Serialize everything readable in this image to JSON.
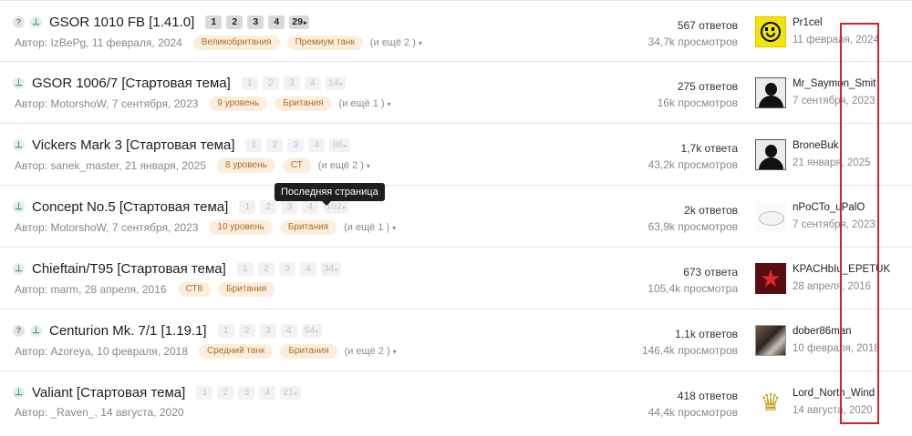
{
  "tooltip": "Последняя страница",
  "colors": {
    "tag_bg": "#fbeedd",
    "tag_text": "#b36b1c",
    "pin_icon": "#3aa36b",
    "highlight_box": "#d8212b",
    "tooltip_bg": "#1e1e1e"
  },
  "topics": [
    {
      "question_icon": true,
      "pin_icon": true,
      "title": "GSOR 1010 FB [1.41.0]",
      "pages_style": "dark",
      "pages": [
        "1",
        "2",
        "3",
        "4",
        "29"
      ],
      "author": "Автор: IzBePg, 11 февраля, 2024",
      "tags": [
        "Великобритания",
        "Премиум танк"
      ],
      "more": "(и ещё 2 )",
      "replies": "567 ответов",
      "views": "34,7k просмотров",
      "avatar": "sun",
      "last_user": "Pr1cel",
      "last_date": "11 февраля, 2024"
    },
    {
      "question_icon": false,
      "pin_icon": true,
      "title": "GSOR 1006/7 [Стартовая тема]",
      "pages_style": "light",
      "pages": [
        "1",
        "2",
        "3",
        "4",
        "14"
      ],
      "author": "Автор: MotorshoW, 7 сентября, 2023",
      "tags": [
        "9 уровень",
        "Британия"
      ],
      "more": "(и ещё 1 )",
      "replies": "275 ответов",
      "views": "16k просмотров",
      "avatar": "default",
      "last_user": "Mr_Saymon_Smit",
      "last_date": "7 сентября, 2023"
    },
    {
      "question_icon": false,
      "pin_icon": true,
      "title": "Vickers Mark 3 [Стартовая тема]",
      "pages_style": "light",
      "pages": [
        "1",
        "2",
        "3",
        "4",
        "86"
      ],
      "author": "Автор: sanek_master, 21 января, 2025",
      "tags": [
        "8 уровень",
        "СТ"
      ],
      "more": "(и ещё 2 )",
      "replies": "1,7k ответа",
      "views": "43,2k просмотров",
      "avatar": "default",
      "last_user": "BroneBuk",
      "last_date": "21 января, 2025"
    },
    {
      "question_icon": false,
      "pin_icon": true,
      "title": "Concept No.5 [Стартовая тема]",
      "pages_style": "light",
      "pages": [
        "1",
        "2",
        "3",
        "4",
        "102"
      ],
      "author": "Автор: MotorshoW, 7 сентября, 2023",
      "tags": [
        "10 уровень",
        "Британия"
      ],
      "more": "(и ещё 1 )",
      "replies": "2k ответов",
      "views": "63,9k просмотров",
      "avatar": "light",
      "last_user": "nPoCTo_uPalO",
      "last_date": "7 сентября, 2023"
    },
    {
      "question_icon": false,
      "pin_icon": true,
      "title": "Chieftain/T95 [Стартовая тема]",
      "pages_style": "light",
      "pages": [
        "1",
        "2",
        "3",
        "4",
        "34"
      ],
      "author": "Автор: marm, 28 апреля, 2016",
      "tags": [
        "СТ8",
        "Британия"
      ],
      "more": "",
      "replies": "673 ответа",
      "views": "105,4k просмотра",
      "avatar": "star",
      "last_user": "KPACHbIu_EPETUK",
      "last_date": "28 апреля, 2016"
    },
    {
      "question_icon": true,
      "pin_icon": true,
      "title": "Centurion Mk. 7/1 [1.19.1]",
      "pages_style": "light",
      "pages": [
        "1",
        "2",
        "3",
        "4",
        "54"
      ],
      "author": "Автор: Azoreya, 10 февраля, 2018",
      "tags": [
        "Средний танк",
        "Британия"
      ],
      "more": "(и ещё 2 )",
      "replies": "1,1k ответов",
      "views": "146,4k просмотров",
      "avatar": "photo",
      "last_user": "dober86man",
      "last_date": "10 февраля, 2018"
    },
    {
      "question_icon": false,
      "pin_icon": true,
      "title": "Valiant [Стартовая тема]",
      "pages_style": "light",
      "pages": [
        "1",
        "2",
        "3",
        "4",
        "21"
      ],
      "author": "Автор: _Raven_, 14 августа, 2020",
      "tags": [],
      "more": "",
      "replies": "418 ответов",
      "views": "44,4k просмотров",
      "avatar": "crown",
      "last_user": "Lord_North_Wind",
      "last_date": "14 августа, 2020"
    }
  ]
}
